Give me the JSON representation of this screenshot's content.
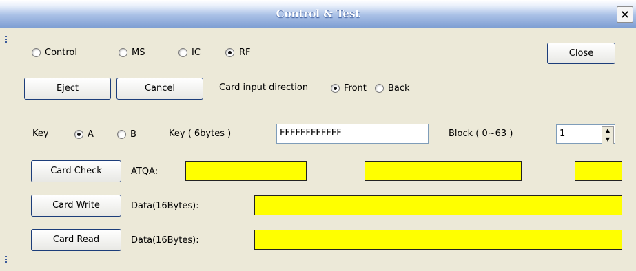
{
  "window": {
    "title": "Control & Test",
    "close_symbol": "×"
  },
  "mode_radios": [
    {
      "label": "Control",
      "checked": false
    },
    {
      "label": "MS",
      "checked": false
    },
    {
      "label": "IC",
      "checked": false
    },
    {
      "label": "RF",
      "checked": true
    }
  ],
  "buttons": {
    "close": "Close",
    "eject": "Eject",
    "cancel": "Cancel",
    "card_check": "Card Check",
    "card_write": "Card Write",
    "card_read": "Card Read"
  },
  "card_direction": {
    "label": "Card input direction",
    "options": [
      {
        "label": "Front",
        "checked": true
      },
      {
        "label": "Back",
        "checked": false
      }
    ]
  },
  "key": {
    "label": "Key",
    "options": [
      {
        "label": "A",
        "checked": true
      },
      {
        "label": "B",
        "checked": false
      }
    ],
    "key_label": "Key ( 6bytes )",
    "key_value": "FFFFFFFFFFFF"
  },
  "block": {
    "label": "Block ( 0~63 )",
    "value": "1"
  },
  "fields": {
    "atqa_label": "ATQA:",
    "write_data_label": "Data(16Bytes):",
    "read_data_label": "Data(16Bytes):"
  },
  "colors": {
    "result_field": "#ffff00",
    "titlebar": "#7f9fd3"
  }
}
